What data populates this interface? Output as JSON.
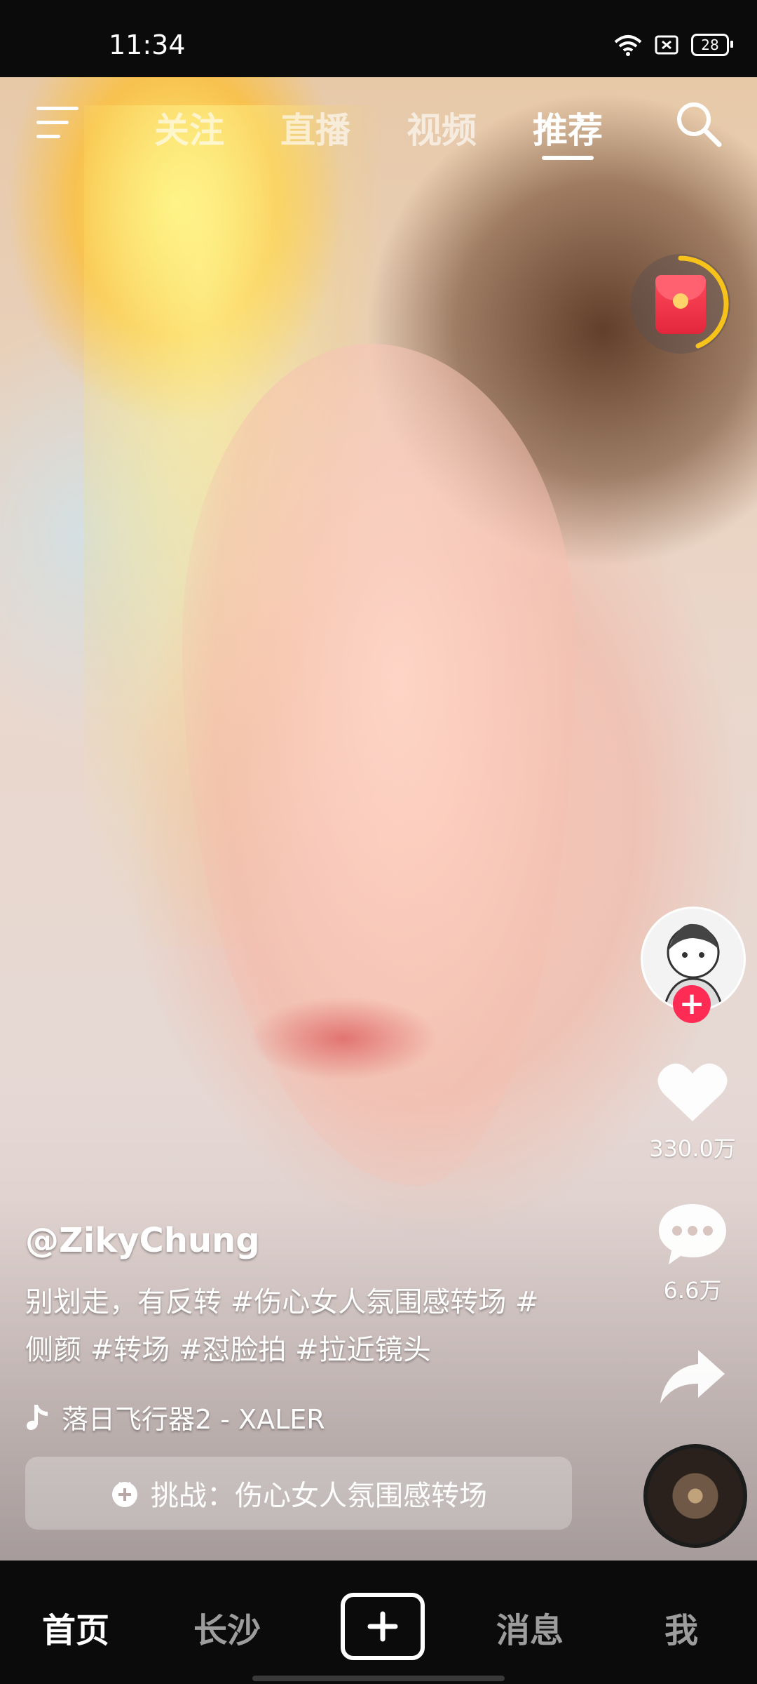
{
  "status_bar": {
    "time": "11:34",
    "battery": "28"
  },
  "top_nav": {
    "tabs": [
      {
        "label": "关注"
      },
      {
        "label": "直播"
      },
      {
        "label": "视频"
      },
      {
        "label": "推荐"
      }
    ],
    "active_tab": "推荐"
  },
  "video": {
    "author": "@ZikyChung",
    "description": "别划走，有反转 #伤心女人氛围感转场 #侧颜 #转场 #怼脸拍 #拉近镜头",
    "music": "落日飞行器2 - XALER",
    "challenge": "挑战：伤心女人氛围感转场"
  },
  "actions": {
    "likes": "330.0万",
    "comments": "6.6万"
  },
  "bottom_nav": {
    "items": [
      {
        "label": "首页"
      },
      {
        "label": "长沙"
      },
      {
        "label": "消息"
      },
      {
        "label": "我"
      }
    ],
    "active": "首页"
  },
  "icons": {
    "menu": "menu-icon",
    "search": "search-icon",
    "red_packet": "red-packet-icon",
    "heart": "heart-icon",
    "comment": "comment-icon",
    "share": "share-icon",
    "music_note": "music-note-icon",
    "challenge": "challenge-icon",
    "plus": "plus-icon"
  },
  "colors": {
    "follow_badge": "#fe2c55",
    "red_packet_ring": "#f7c21a"
  }
}
